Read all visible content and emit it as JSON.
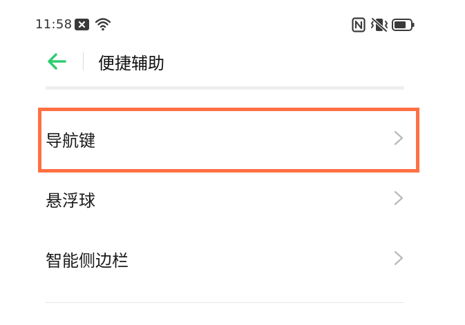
{
  "status_bar": {
    "time": "11:58",
    "icons": [
      "notification-x-icon",
      "wifi-icon",
      "nfc-icon",
      "vibrate-silent-icon",
      "battery-icon"
    ]
  },
  "header": {
    "back_icon": "arrow-left-icon",
    "title": "便捷辅助",
    "accent_color": "#2ecc71"
  },
  "settings": {
    "items": [
      {
        "label": "导航键",
        "highlighted": true
      },
      {
        "label": "悬浮球",
        "highlighted": false
      },
      {
        "label": "智能侧边栏",
        "highlighted": false
      }
    ]
  },
  "highlight_color": "#ff7043"
}
